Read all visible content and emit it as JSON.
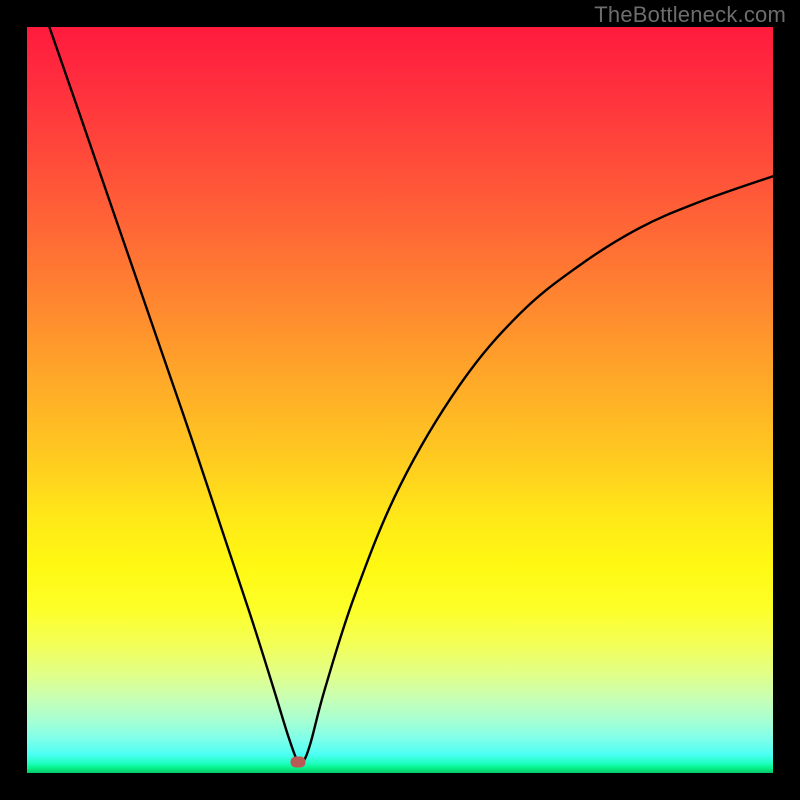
{
  "watermark": "TheBottleneck.com",
  "chart_data": {
    "type": "line",
    "title": "",
    "xlabel": "",
    "ylabel": "",
    "xlim": [
      0,
      100
    ],
    "ylim": [
      0,
      100
    ],
    "grid": false,
    "legend": false,
    "series": [
      {
        "name": "curve",
        "x": [
          3,
          7,
          12,
          17,
          22,
          26,
          30,
          33,
          35,
          36.3,
          37,
          38,
          40,
          44,
          50,
          58,
          66,
          74,
          82,
          90,
          100
        ],
        "values": [
          100,
          88.5,
          74,
          59.5,
          45,
          33,
          21,
          11.5,
          5,
          1.5,
          1.5,
          4,
          11.5,
          24,
          38.5,
          52,
          61.5,
          68,
          73,
          76.5,
          80
        ]
      }
    ],
    "min_marker": {
      "x": 36.3,
      "y": 1.5
    },
    "gradient_stops": [
      {
        "pos": 0,
        "color": "#ff1b3d"
      },
      {
        "pos": 50,
        "color": "#ffcb20"
      },
      {
        "pos": 78,
        "color": "#fdff28"
      },
      {
        "pos": 100,
        "color": "#04c867"
      }
    ]
  }
}
